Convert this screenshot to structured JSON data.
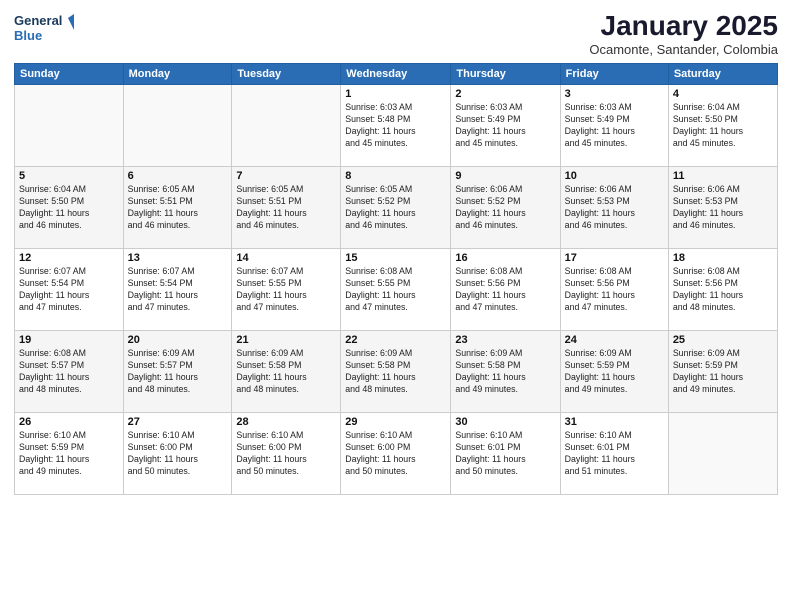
{
  "header": {
    "logo_line1": "General",
    "logo_line2": "Blue",
    "month": "January 2025",
    "location": "Ocamonte, Santander, Colombia"
  },
  "weekdays": [
    "Sunday",
    "Monday",
    "Tuesday",
    "Wednesday",
    "Thursday",
    "Friday",
    "Saturday"
  ],
  "weeks": [
    [
      {
        "day": "",
        "info": ""
      },
      {
        "day": "",
        "info": ""
      },
      {
        "day": "",
        "info": ""
      },
      {
        "day": "1",
        "info": "Sunrise: 6:03 AM\nSunset: 5:48 PM\nDaylight: 11 hours\nand 45 minutes."
      },
      {
        "day": "2",
        "info": "Sunrise: 6:03 AM\nSunset: 5:49 PM\nDaylight: 11 hours\nand 45 minutes."
      },
      {
        "day": "3",
        "info": "Sunrise: 6:03 AM\nSunset: 5:49 PM\nDaylight: 11 hours\nand 45 minutes."
      },
      {
        "day": "4",
        "info": "Sunrise: 6:04 AM\nSunset: 5:50 PM\nDaylight: 11 hours\nand 45 minutes."
      }
    ],
    [
      {
        "day": "5",
        "info": "Sunrise: 6:04 AM\nSunset: 5:50 PM\nDaylight: 11 hours\nand 46 minutes."
      },
      {
        "day": "6",
        "info": "Sunrise: 6:05 AM\nSunset: 5:51 PM\nDaylight: 11 hours\nand 46 minutes."
      },
      {
        "day": "7",
        "info": "Sunrise: 6:05 AM\nSunset: 5:51 PM\nDaylight: 11 hours\nand 46 minutes."
      },
      {
        "day": "8",
        "info": "Sunrise: 6:05 AM\nSunset: 5:52 PM\nDaylight: 11 hours\nand 46 minutes."
      },
      {
        "day": "9",
        "info": "Sunrise: 6:06 AM\nSunset: 5:52 PM\nDaylight: 11 hours\nand 46 minutes."
      },
      {
        "day": "10",
        "info": "Sunrise: 6:06 AM\nSunset: 5:53 PM\nDaylight: 11 hours\nand 46 minutes."
      },
      {
        "day": "11",
        "info": "Sunrise: 6:06 AM\nSunset: 5:53 PM\nDaylight: 11 hours\nand 46 minutes."
      }
    ],
    [
      {
        "day": "12",
        "info": "Sunrise: 6:07 AM\nSunset: 5:54 PM\nDaylight: 11 hours\nand 47 minutes."
      },
      {
        "day": "13",
        "info": "Sunrise: 6:07 AM\nSunset: 5:54 PM\nDaylight: 11 hours\nand 47 minutes."
      },
      {
        "day": "14",
        "info": "Sunrise: 6:07 AM\nSunset: 5:55 PM\nDaylight: 11 hours\nand 47 minutes."
      },
      {
        "day": "15",
        "info": "Sunrise: 6:08 AM\nSunset: 5:55 PM\nDaylight: 11 hours\nand 47 minutes."
      },
      {
        "day": "16",
        "info": "Sunrise: 6:08 AM\nSunset: 5:56 PM\nDaylight: 11 hours\nand 47 minutes."
      },
      {
        "day": "17",
        "info": "Sunrise: 6:08 AM\nSunset: 5:56 PM\nDaylight: 11 hours\nand 47 minutes."
      },
      {
        "day": "18",
        "info": "Sunrise: 6:08 AM\nSunset: 5:56 PM\nDaylight: 11 hours\nand 48 minutes."
      }
    ],
    [
      {
        "day": "19",
        "info": "Sunrise: 6:08 AM\nSunset: 5:57 PM\nDaylight: 11 hours\nand 48 minutes."
      },
      {
        "day": "20",
        "info": "Sunrise: 6:09 AM\nSunset: 5:57 PM\nDaylight: 11 hours\nand 48 minutes."
      },
      {
        "day": "21",
        "info": "Sunrise: 6:09 AM\nSunset: 5:58 PM\nDaylight: 11 hours\nand 48 minutes."
      },
      {
        "day": "22",
        "info": "Sunrise: 6:09 AM\nSunset: 5:58 PM\nDaylight: 11 hours\nand 48 minutes."
      },
      {
        "day": "23",
        "info": "Sunrise: 6:09 AM\nSunset: 5:58 PM\nDaylight: 11 hours\nand 49 minutes."
      },
      {
        "day": "24",
        "info": "Sunrise: 6:09 AM\nSunset: 5:59 PM\nDaylight: 11 hours\nand 49 minutes."
      },
      {
        "day": "25",
        "info": "Sunrise: 6:09 AM\nSunset: 5:59 PM\nDaylight: 11 hours\nand 49 minutes."
      }
    ],
    [
      {
        "day": "26",
        "info": "Sunrise: 6:10 AM\nSunset: 5:59 PM\nDaylight: 11 hours\nand 49 minutes."
      },
      {
        "day": "27",
        "info": "Sunrise: 6:10 AM\nSunset: 6:00 PM\nDaylight: 11 hours\nand 50 minutes."
      },
      {
        "day": "28",
        "info": "Sunrise: 6:10 AM\nSunset: 6:00 PM\nDaylight: 11 hours\nand 50 minutes."
      },
      {
        "day": "29",
        "info": "Sunrise: 6:10 AM\nSunset: 6:00 PM\nDaylight: 11 hours\nand 50 minutes."
      },
      {
        "day": "30",
        "info": "Sunrise: 6:10 AM\nSunset: 6:01 PM\nDaylight: 11 hours\nand 50 minutes."
      },
      {
        "day": "31",
        "info": "Sunrise: 6:10 AM\nSunset: 6:01 PM\nDaylight: 11 hours\nand 51 minutes."
      },
      {
        "day": "",
        "info": ""
      }
    ]
  ]
}
